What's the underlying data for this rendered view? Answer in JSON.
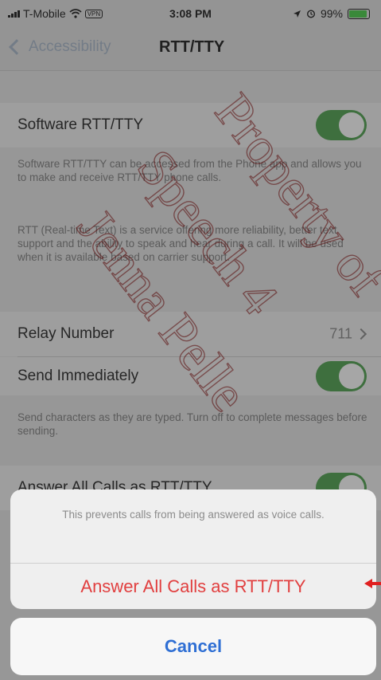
{
  "status_bar": {
    "carrier": "T-Mobile",
    "vpn": "VPN",
    "time": "3:08 PM",
    "battery": "99%",
    "battery_color": "#3a9a3a"
  },
  "nav": {
    "back_label": "Accessibility",
    "title": "RTT/TTY"
  },
  "settings": {
    "software_rtt": {
      "label": "Software RTT/TTY",
      "on": true,
      "desc1": "Software RTT/TTY can be accessed from the Phone app and allows you to make and receive RTT/TTY phone calls.",
      "desc2": "RTT (Real-time Text) is a service offering more reliability, better text support and the ability to speak and hear during a call. It will be used when it is available based on carrier support."
    },
    "relay": {
      "label": "Relay Number",
      "value": "711"
    },
    "send_immediately": {
      "label": "Send Immediately",
      "on": true,
      "desc": "Send characters as they are typed. Turn off to complete messages before sending."
    },
    "answer_all": {
      "label": "Answer All Calls as RTT/TTY",
      "on": true
    }
  },
  "action_sheet": {
    "message": "This prevents calls from being answered as voice calls.",
    "action_label": "Answer All Calls as RTT/TTY",
    "cancel_label": "Cancel",
    "destructive_color": "#e13f3f",
    "cancel_color": "#2f6fd4"
  },
  "watermark": {
    "line1": "Property of",
    "line2": "Speech 4",
    "line3": "Jenna Pelle"
  },
  "icons": [
    "signal-bars-icon",
    "wifi-icon",
    "location-icon",
    "alarm-icon",
    "battery-icon",
    "chevron-left-icon",
    "chevron-right-icon",
    "red-arrow-icon"
  ]
}
